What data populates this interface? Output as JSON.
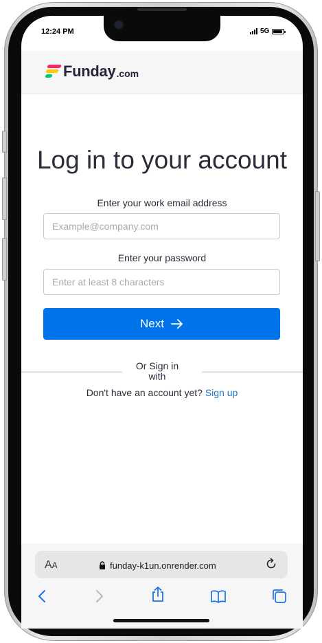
{
  "status_bar": {
    "time": "12:24 PM",
    "network": "5G",
    "battery_level": 0.9
  },
  "header": {
    "brand_name": "Funday",
    "brand_tld": ".com",
    "logo_colors": [
      "#fb275d",
      "#ffcb00",
      "#00ca72"
    ]
  },
  "login": {
    "title": "Log in to your account",
    "email_label": "Enter your work email address",
    "email_placeholder": "Example@company.com",
    "email_value": "",
    "password_label": "Enter your password",
    "password_placeholder": "Enter at least 8 characters",
    "password_value": "",
    "next_label": "Next",
    "or_sign_in_text": "Or Sign in with",
    "no_account_text": "Don't have an account yet?",
    "sign_up_label": "Sign up"
  },
  "browser": {
    "text_size_label_big": "A",
    "text_size_label_small": "A",
    "url": "funday-k1un.onrender.com"
  },
  "colors": {
    "accent": "#0073ea",
    "link": "#1f76c2",
    "text": "#2c2c3a"
  },
  "icons": [
    "lock-icon",
    "reload-icon",
    "back-icon",
    "forward-icon",
    "share-icon",
    "bookmarks-icon",
    "tabs-icon",
    "arrow-right-icon"
  ]
}
